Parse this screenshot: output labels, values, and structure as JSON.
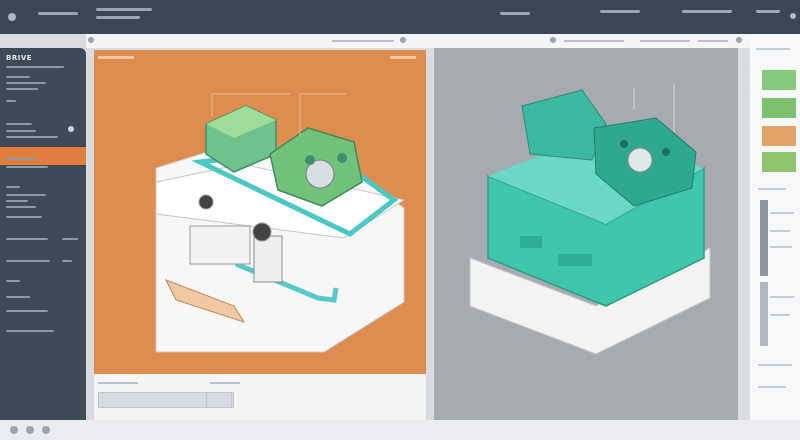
{
  "app": {
    "sidebar_title": "BRIVE"
  },
  "icons": {
    "top_left_circle": "circle-icon",
    "search": "search-icon",
    "settings": "gear-icon",
    "expand": "expand-icon"
  },
  "colors": {
    "topbar": "#3b4655",
    "sidebar": "#3f4a59",
    "accent_orange": "#e07e40",
    "left_canvas_bg": "#de8d4e",
    "right_canvas_bg": "#a7abb0",
    "teal_model": "#3fc6ad",
    "green_part": "#86c97a"
  }
}
